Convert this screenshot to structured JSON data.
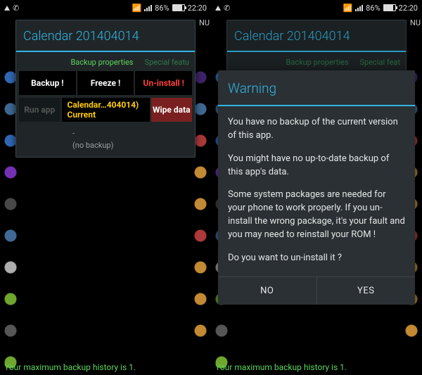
{
  "status": {
    "battery_pct": "86%",
    "time": "22:20",
    "nu_label": "NU"
  },
  "panel": {
    "title": "Calendar 201404014",
    "tabs": {
      "props": "Backup properties",
      "feat": "Special featu"
    },
    "feat_full_cut": "Special feat",
    "buttons": {
      "backup": "Backup !",
      "freeze": "Freeze !",
      "uninstall": "Un-install !",
      "run": "Run app",
      "wipe": "Wipe data"
    },
    "current": {
      "line1": "Calendar…404014)",
      "line2": "Current"
    },
    "no_backup_dash": "-",
    "no_backup": "(no backup)"
  },
  "footer": {
    "text": "Your maximum backup history is 1."
  },
  "dialog": {
    "title": "Warning",
    "p1": "You have no backup of the current version of this app.",
    "p2": "You might have no up-to-date backup of this app's data.",
    "p3": "Some system packages are needed for your phone to work properly. If you un-install the wrong package, it's your fault and you may need to reinstall your ROM !",
    "p4": "Do you want to un-install it ?",
    "no": "NO",
    "yes": "YES"
  }
}
